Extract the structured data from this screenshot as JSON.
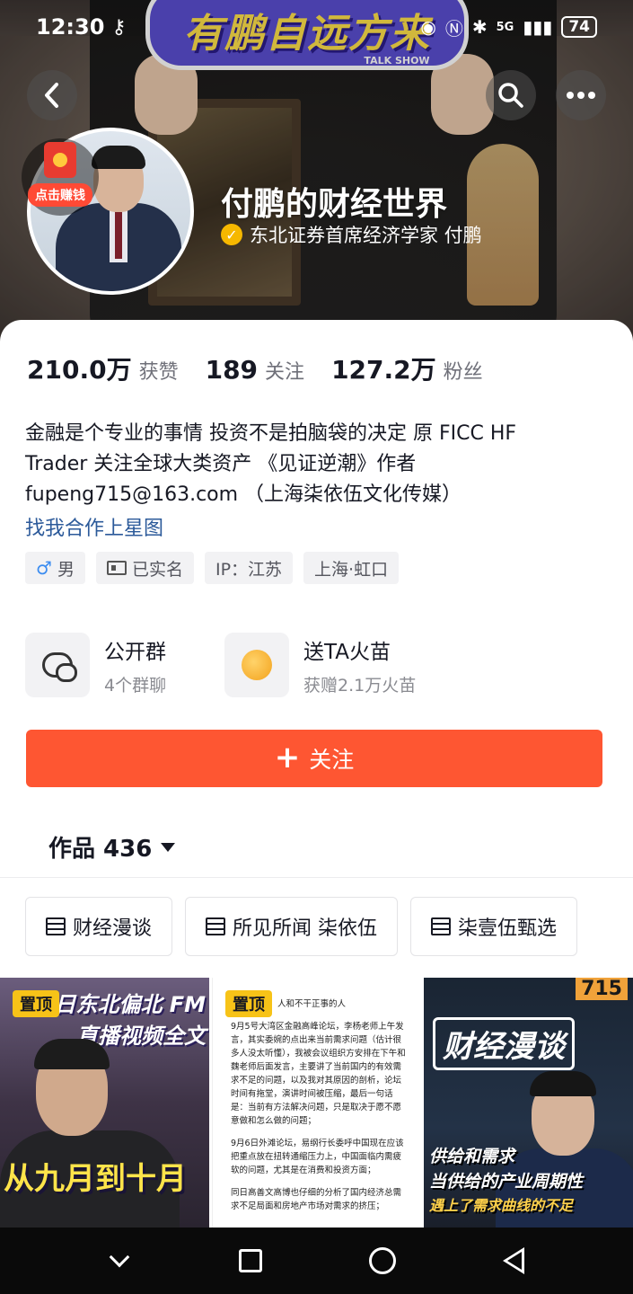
{
  "status_bar": {
    "time": "12:30",
    "network": "5G",
    "battery": "74"
  },
  "header": {
    "banner_title": "有鹏自远方来",
    "banner_subtitle": "TALK SHOW",
    "back_icon": "chevron-left-icon",
    "search_icon": "search-icon",
    "more_icon": "more-horizontal-icon"
  },
  "profile": {
    "earn_badge_label": "点击赚钱",
    "name": "付鹏的财经世界",
    "verification": "东北证券首席经济学家 付鹏"
  },
  "stats": [
    {
      "value": "210.0万",
      "label": "获赞"
    },
    {
      "value": "189",
      "label": "关注"
    },
    {
      "value": "127.2万",
      "label": "粉丝"
    }
  ],
  "bio": {
    "line1": "金融是个专业的事情 投资不是拍脑袋的决定 原 FICC HF",
    "line2": "Trader 关注全球大类资产 《见证逆潮》作者",
    "line3": "fupeng715@163.com （上海柒依伍文化传媒）",
    "collab_link": "找我合作上星图"
  },
  "tags": {
    "gender_symbol": "♂",
    "gender": "男",
    "verified": "已实名",
    "ip": "IP：江苏",
    "location": "上海·虹口"
  },
  "features": [
    {
      "title": "公开群",
      "subtitle": "4个群聊",
      "icon": "chat-bubbles-icon"
    },
    {
      "title": "送TA火苗",
      "subtitle": "获赠2.1万火苗",
      "icon": "flame-coin-icon"
    }
  ],
  "follow_button": "关注",
  "works_tab": "作品 436",
  "collections": [
    {
      "label": "财经漫谈"
    },
    {
      "label": "所见所闻 柒依伍"
    },
    {
      "label": "柒壹伍甄选"
    }
  ],
  "videos": {
    "pin_label": "置顶",
    "v1_header": "月7日东北偏北 FM直播视频全文",
    "v1_caption": "从九月到十月",
    "v2_title": "人和不干正事的人",
    "v2_p1": "9月5号大湾区金融高峰论坛，李杨老师上午发言，其实委婉的点出来当前需求问题（估计很多人没太听懂），我被会议组织方安排在下午和魏老师后面发言，主要讲了当前国内的有效需求不足的问题，以及我对其原因的剖析，论坛时间有拖堂，演讲时间被压缩，最后一句话是：当前有方法解决问题，只是取决于愿不愿意做和怎么做的问题；",
    "v2_p2": "9月6日外滩论坛，易纲行长委呼中国现在应该把重点放在扭转通缩压力上，中国面临内需疲软的问题，尤其是在消费和投资方面；",
    "v2_p3": "同日高善文高博也仔细的分析了国内经济总需求不足局面和房地产市场对需求的挤压；",
    "v3_badge": "715",
    "v3_title": "财经漫谈",
    "v3_cap1": "供给和需求",
    "v3_cap2": "当供给的产业周期性",
    "v3_cap3": "遇上了需求曲线的不足"
  },
  "colors": {
    "accent": "#fe5632",
    "link": "#2c5a9a",
    "verify": "#f6b800"
  }
}
